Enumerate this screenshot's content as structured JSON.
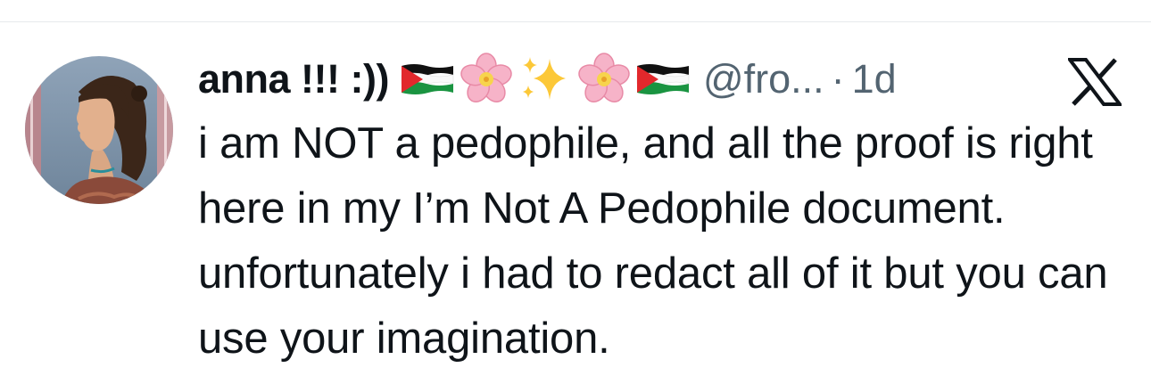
{
  "tweet": {
    "display_name": "anna !!! :))",
    "name_emojis": [
      "palestine-flag",
      "cherry-blossom",
      "sparkles",
      "cherry-blossom",
      "palestine-flag"
    ],
    "handle": "@fro...",
    "separator": "·",
    "time": "1d",
    "body": "i am NOT a pedophile, and all the proof is right here in my I’m Not A Pedophile document. unfortunately i had to redact all of it but you can use your imagination."
  },
  "icons": {
    "brand": "x-logo-icon",
    "avatar": "profile-avatar"
  },
  "colors": {
    "text_primary": "#0f1419",
    "text_secondary": "#536471",
    "divider": "#e6e9ec"
  }
}
